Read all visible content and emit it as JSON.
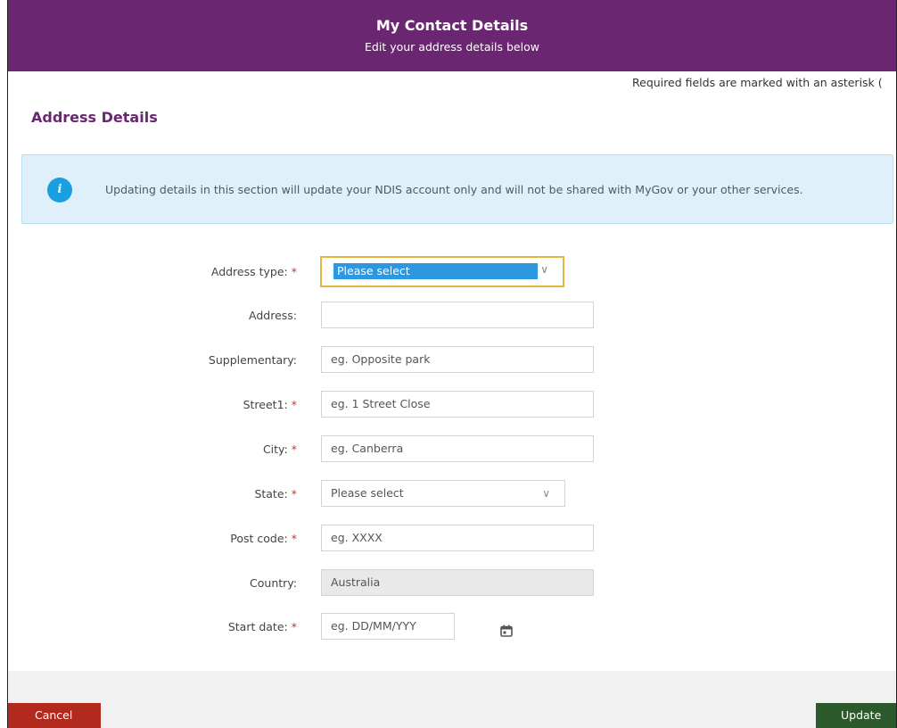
{
  "header": {
    "title": "My Contact Details",
    "subtitle": "Edit your address details below",
    "background_color": "#6b2671"
  },
  "required_note": "Required fields are marked with an asterisk (",
  "section": {
    "title": "Address Details"
  },
  "info": {
    "icon": "info-icon",
    "icon_glyph": "i",
    "text": "Updating details in this section will update your NDIS account only and will not be shared with MyGov or your other services."
  },
  "form": {
    "required_marker": "*",
    "address_type": {
      "label": "Address type:",
      "value": "Please select",
      "required": true
    },
    "address": {
      "label": "Address:",
      "value": "",
      "required": false
    },
    "supplementary": {
      "label": "Supplementary:",
      "placeholder": "eg. Opposite park",
      "required": false
    },
    "street1": {
      "label": "Street1:",
      "placeholder": "eg. 1 Street Close",
      "required": true
    },
    "city": {
      "label": "City:",
      "placeholder": "eg. Canberra",
      "required": true
    },
    "state": {
      "label": "State:",
      "value": "Please select",
      "required": true
    },
    "post_code": {
      "label": "Post code:",
      "placeholder": "eg. XXXX",
      "required": true
    },
    "country": {
      "label": "Country:",
      "value": "Australia",
      "required": false
    },
    "start_date": {
      "label": "Start date:",
      "placeholder": "eg. DD/MM/YYY",
      "required": true,
      "icon": "calendar-icon"
    }
  },
  "buttons": {
    "cancel": "Cancel",
    "update": "Update",
    "cancel_color": "#b2291e",
    "update_color": "#2c5a2c"
  }
}
